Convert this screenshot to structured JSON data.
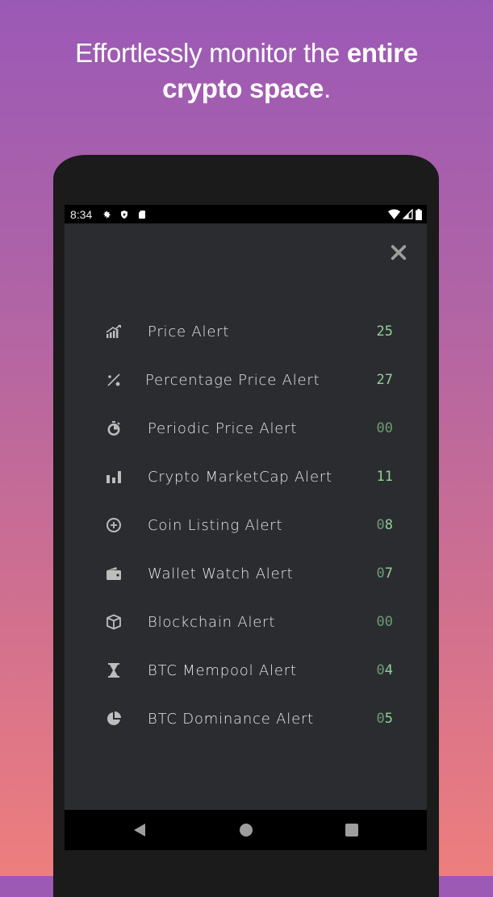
{
  "headline": {
    "light": "Effortlessly monitor the ",
    "bold1": "entire",
    "bold2": "crypto space",
    "end": "."
  },
  "statusbar": {
    "time": "8:34",
    "left_icons": [
      "gear-icon",
      "shield-play-icon",
      "sd-card-icon"
    ],
    "right_icons": [
      "wifi-icon",
      "signal-icon",
      "battery-icon"
    ]
  },
  "colors": {
    "count_active": "#8fd19a",
    "count_zero": "#6d9a74",
    "icon": "#bdbdbd",
    "label": "#e8e8e8"
  },
  "alerts": [
    {
      "label": "Price Alert",
      "count": "25",
      "icon": "trending-bars-icon",
      "lead_zero": false
    },
    {
      "label": "Percentage Price Alert",
      "count": "27",
      "icon": "percent-icon",
      "lead_zero": false
    },
    {
      "label": "Periodic Price Alert",
      "count": "00",
      "icon": "stopwatch-icon",
      "lead_zero": true
    },
    {
      "label": "Crypto MarketCap Alert",
      "count": "11",
      "icon": "bar-chart-icon",
      "lead_zero": false
    },
    {
      "label": "Coin Listing Alert",
      "count": "08",
      "icon": "add-circle-icon",
      "lead_zero": true
    },
    {
      "label": "Wallet Watch Alert",
      "count": "07",
      "icon": "wallet-icon",
      "lead_zero": true
    },
    {
      "label": "Blockchain Alert",
      "count": "00",
      "icon": "cube-icon",
      "lead_zero": true
    },
    {
      "label": "BTC Mempool Alert",
      "count": "04",
      "icon": "hourglass-icon",
      "lead_zero": true
    },
    {
      "label": "BTC Dominance Alert",
      "count": "05",
      "icon": "pie-chart-icon",
      "lead_zero": true
    }
  ],
  "navbar": {
    "back": "back-icon",
    "home": "home-icon",
    "recents": "recents-icon"
  }
}
